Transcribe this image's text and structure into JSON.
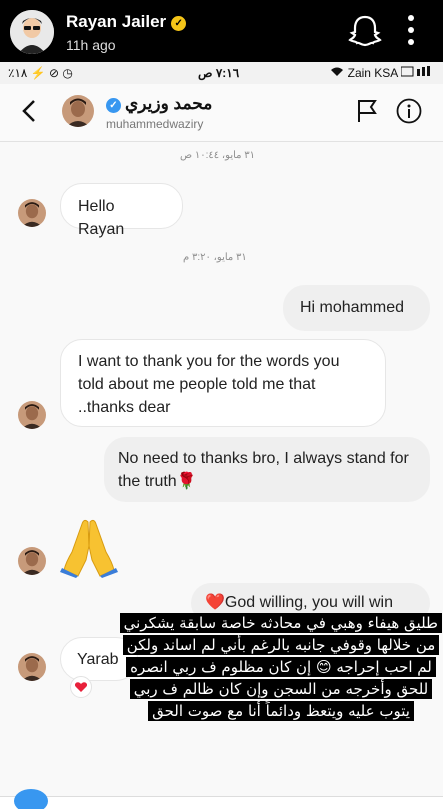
{
  "snap_header": {
    "name": "Rayan Jailer",
    "badge": "✓",
    "time": "11h ago"
  },
  "statusbar": {
    "left": "٪١٨ ⚡ ⊘ ◷",
    "time": "٧:١٦ ص",
    "carrier": "Zain KSA"
  },
  "chat": {
    "name": "محمد وزيري",
    "username": "muhammedwaziry",
    "verified": "✓"
  },
  "messages": {
    "ts1": "٣١ مايو، ١٠:٤٤ ص",
    "m1": "Hello Rayan",
    "ts2": "٣١ مايو، ٣:٢٠ م",
    "m2": "Hi mohammed",
    "m3": "I want to thank you for the words you told about me people told me that ..thanks dear",
    "m4": "No need to thanks bro, I always stand for the truth🌹",
    "m5": "❤️God willing, you will win",
    "m6": "Yarab"
  },
  "caption": {
    "text": "طليق هيفاء وهبي في محادثه خاصة سابقة يشكرني من خلالها وقوفي جانبه بالرغم بأني لم اساند ولكن لم احب إحراجه 😊 إن كان مظلوم ف ربي انصره للحق وأخرجه من السجن وإن كان ظالم ف ربي يتوب عليه ويتعظ ودائماً أنا مع صوت الحق"
  },
  "colors": {
    "verified": "#3897f0",
    "badge": "#f5c518",
    "heart": "#e8213b"
  }
}
